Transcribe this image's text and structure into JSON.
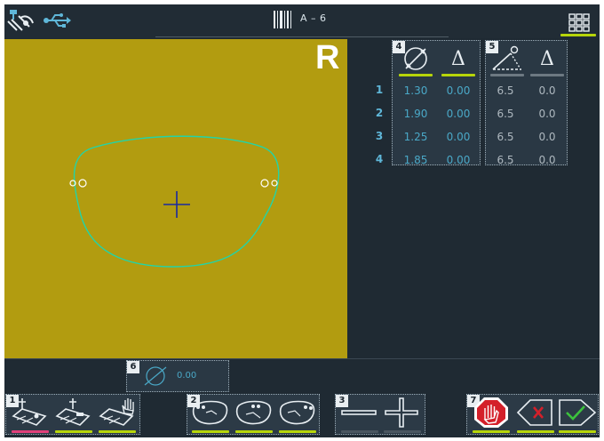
{
  "header": {
    "job_label": "A – 6",
    "icons": [
      "tracer-icon",
      "usb-icon",
      "barcode-icon",
      "grid-menu-icon"
    ]
  },
  "lens_view": {
    "eye_side": "R",
    "background_color": "#b29c10",
    "outline_color": "#22d4a8",
    "crosshair_color": "#1a2aa0"
  },
  "table_4": {
    "number": "4",
    "columns": [
      "diameter-icon",
      "Δ"
    ],
    "rows": [
      {
        "row": "1",
        "diameter": "1.30",
        "delta": "0.00"
      },
      {
        "row": "2",
        "diameter": "1.90",
        "delta": "0.00"
      },
      {
        "row": "3",
        "diameter": "1.25",
        "delta": "0.00"
      },
      {
        "row": "4",
        "diameter": "1.85",
        "delta": "0.00"
      }
    ]
  },
  "table_5": {
    "number": "5",
    "columns": [
      "angle-icon",
      "Δ"
    ],
    "rows": [
      {
        "angle": "6.5",
        "delta": "0.0"
      },
      {
        "angle": "6.5",
        "delta": "0.0"
      },
      {
        "angle": "6.5",
        "delta": "0.0"
      },
      {
        "angle": "6.5",
        "delta": "0.0"
      }
    ]
  },
  "panel_6": {
    "number": "6",
    "value": "0.00"
  },
  "toolbar": {
    "group_1": {
      "number": "1",
      "buttons": [
        "drill-hole-icon",
        "drill-slot-icon",
        "drill-manual-icon"
      ]
    },
    "group_2": {
      "number": "2",
      "buttons": [
        "hole-position-left-icon",
        "hole-position-center-icon",
        "hole-position-right-icon"
      ]
    },
    "group_3": {
      "number": "3",
      "buttons": [
        "minus-icon",
        "plus-icon"
      ]
    },
    "group_7": {
      "number": "7",
      "buttons": [
        "stop-icon",
        "cancel-icon",
        "confirm-icon"
      ]
    }
  },
  "colors": {
    "accent_lime": "#b7d50a",
    "accent_pink": "#e0407a",
    "value_blue": "#4aa8c7",
    "stop_red": "#d4202a",
    "confirm_green": "#3cc23c"
  }
}
